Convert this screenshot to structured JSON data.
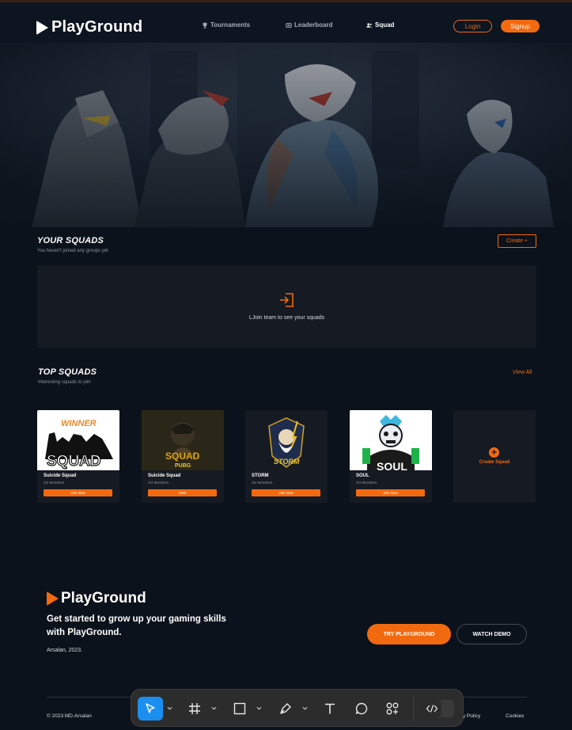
{
  "header": {
    "brand": "PlayGround",
    "nav": [
      {
        "label": "Tournaments",
        "icon": "trophy-icon",
        "active": false
      },
      {
        "label": "Leaderboard",
        "icon": "leaderboard-icon",
        "active": false
      },
      {
        "label": "Squad",
        "icon": "users-icon",
        "active": true
      }
    ],
    "login_label": "Login",
    "signup_label": "Signup"
  },
  "your_squads": {
    "title": "YOUR SQUADS",
    "subtitle": "You haven't joined any groups yet",
    "create_label": "Create +",
    "empty_message": "LJoin team to see your squads"
  },
  "top_squads": {
    "title": "TOP SQUADS",
    "subtitle": "Interesting squads to join",
    "view_all_label": "View All",
    "cards": [
      {
        "name": "Suicide Squad",
        "members": "3/4 Members",
        "button": "Join Now"
      },
      {
        "name": "Suicide Squad",
        "members": "4/4 Members",
        "button": "View"
      },
      {
        "name": "STORM",
        "members": "3/4 Members",
        "button": "Join Now"
      },
      {
        "name": "SOUL",
        "members": "3/4 Members",
        "button": "Join Now"
      }
    ],
    "create_card_label": "Create Squad"
  },
  "footer": {
    "brand": "PlayGround",
    "tagline": "Get started to grow up your gaming skills with PlayGround.",
    "author": "Arsalan, 2023.",
    "try_label": "TRY PLAYGROUND",
    "demo_label": "WATCH DEMO",
    "copyright": "© 2023  MD.Arsalan",
    "privacy": "acy Policy",
    "cookies": "Cookies"
  },
  "colors": {
    "accent": "#f26a0f",
    "background": "#0b121b",
    "card": "#151a23",
    "toolbar_selected": "#1b8ff0"
  }
}
